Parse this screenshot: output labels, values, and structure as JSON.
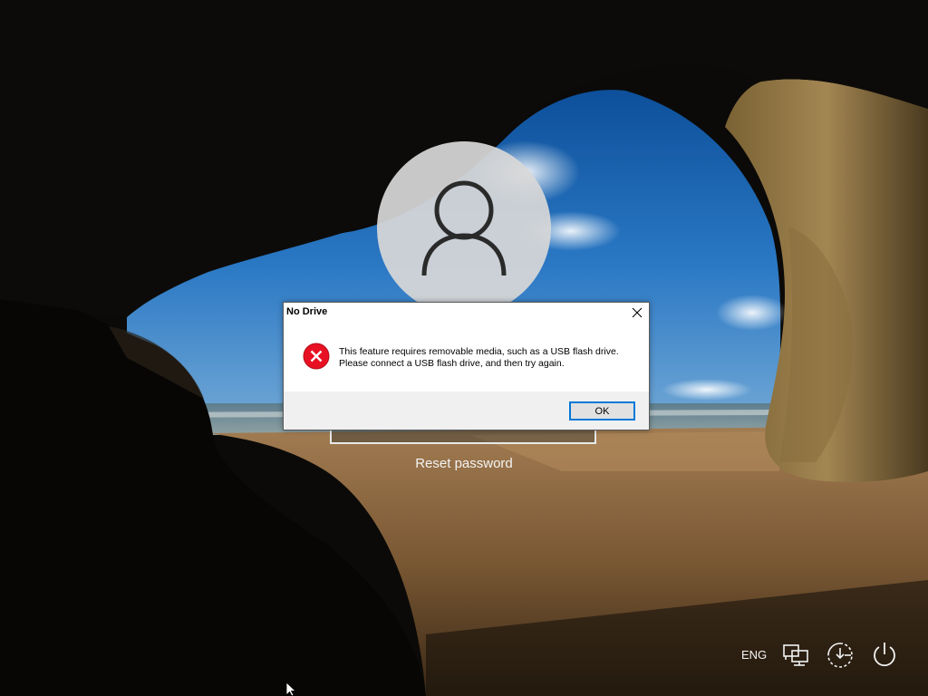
{
  "lock_screen": {
    "reset_password_label": "Reset password"
  },
  "dialog": {
    "title": "No Drive",
    "message_line1": "This feature requires removable media, such as a USB flash drive.",
    "message_line2": "Please connect a USB flash drive, and then try again.",
    "ok_label": "OK",
    "icon": "error-icon",
    "close_icon": "close-icon"
  },
  "tray": {
    "language": "ENG",
    "icons": [
      "network-icon",
      "ease-of-access-icon",
      "power-icon"
    ]
  },
  "colors": {
    "error_red": "#e81123",
    "focus_blue": "#0078d7",
    "dialog_footer": "#f0f0f0"
  }
}
